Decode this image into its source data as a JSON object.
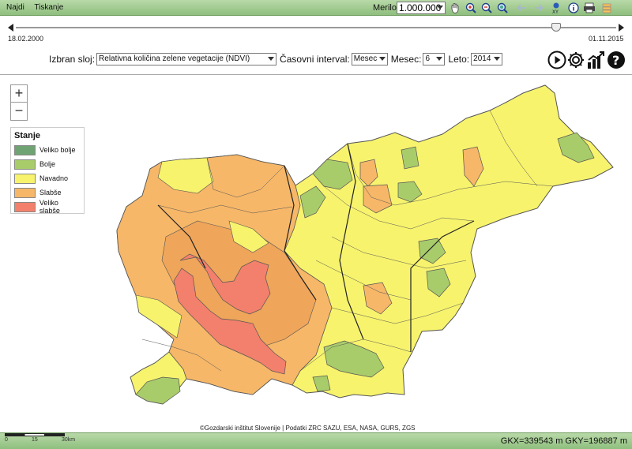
{
  "menu": {
    "find": "Najdi",
    "print": "Tiskanje"
  },
  "toolbar": {
    "scale_label": "Merilo:",
    "scale_value": "1.000.000",
    "icons": [
      "hand-icon",
      "zoom-in-icon",
      "zoom-out-icon",
      "zoom-extent-icon",
      "back-icon",
      "forward-icon",
      "xy-icon",
      "info-icon",
      "print-icon",
      "layers-icon"
    ]
  },
  "timeline": {
    "start": "18.02.2000",
    "end": "01.11.2015",
    "position_fraction": 0.89
  },
  "controls": {
    "layer_label": "Izbran sloj:",
    "layer_value": "Relativna količina zelene vegetacije (NDVI)",
    "interval_label": "Časovni interval:",
    "interval_value": "Mesec",
    "month_label": "Mesec:",
    "month_value": "6",
    "year_label": "Leto:",
    "year_value": "2014"
  },
  "legend": {
    "title": "Stanje",
    "items": [
      {
        "label": "Veliko bolje",
        "color": "#6fa373"
      },
      {
        "label": "Bolje",
        "color": "#a9cc6b"
      },
      {
        "label": "Navadno",
        "color": "#f7f36d"
      },
      {
        "label": "Slabše",
        "color": "#f6b768"
      },
      {
        "label": "Veliko slabše",
        "color": "#f2806c"
      }
    ]
  },
  "colors": {
    "very_better": "#6fa373",
    "better": "#a9cc6b",
    "normal": "#f7f36d",
    "worse": "#f6b768",
    "much_worse": "#f2806c",
    "orange_dark": "#efa55a",
    "bar_green": "#9fcc8c"
  },
  "credit": "©Gozdarski inštitut Slovenije | Podatki ZRC SAZU, ESA, NASA, GURS, ZGS",
  "scalebar": {
    "t0": "0",
    "t1": "15",
    "t2": "30km"
  },
  "coords": "GKX=339543 m GKY=196887 m"
}
